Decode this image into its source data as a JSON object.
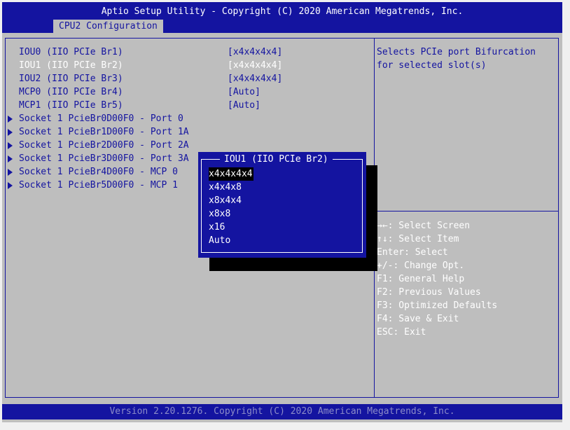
{
  "header": {
    "title": "Aptio Setup Utility - Copyright (C) 2020 American Megatrends, Inc.",
    "tab": "CPU2 Configuration"
  },
  "settings": [
    {
      "label": "IOU0 (IIO PCIe Br1)",
      "value": "[x4x4x4x4]"
    },
    {
      "label": "IOU1 (IIO PCIe Br2)",
      "value": "[x4x4x4x4]"
    },
    {
      "label": "IOU2 (IIO PCIe Br3)",
      "value": "[x4x4x4x4]"
    },
    {
      "label": "MCP0 (IIO PCIe Br4)",
      "value": "[Auto]"
    },
    {
      "label": "MCP1 (IIO PCIe Br5)",
      "value": "[Auto]"
    }
  ],
  "submenus": [
    {
      "label": "Socket 1 PcieBr0D00F0 - Port 0"
    },
    {
      "label": "Socket 1 PcieBr1D00F0 - Port 1A"
    },
    {
      "label": "Socket 1 PcieBr2D00F0 - Port 2A"
    },
    {
      "label": "Socket 1 PcieBr3D00F0 - Port 3A"
    },
    {
      "label": "Socket 1 PcieBr4D00F0 - MCP 0"
    },
    {
      "label": "Socket 1 PcieBr5D00F0 - MCP 1"
    }
  ],
  "help_text": "Selects PCIe port Bifurcation for selected slot(s)",
  "keys": [
    "→←: Select Screen",
    "↑↓: Select Item",
    "Enter: Select",
    "+/-: Change Opt.",
    "F1: General Help",
    "F2: Previous Values",
    "F3: Optimized Defaults",
    "F4: Save & Exit",
    "ESC: Exit"
  ],
  "popup": {
    "title": "IOU1 (IIO PCIe Br2)",
    "options": [
      "x4x4x4x4",
      "x4x4x8",
      "x8x4x4",
      "x8x8",
      "x16",
      "Auto"
    ],
    "selected": "x4x4x4x4"
  },
  "footer": {
    "version": "Version 2.20.1276. Copyright (C) 2020 American Megatrends, Inc."
  },
  "colors": {
    "bios_blue": "#1414a0",
    "bios_gray": "#bebebe",
    "highlight_white": "#ffffff"
  }
}
